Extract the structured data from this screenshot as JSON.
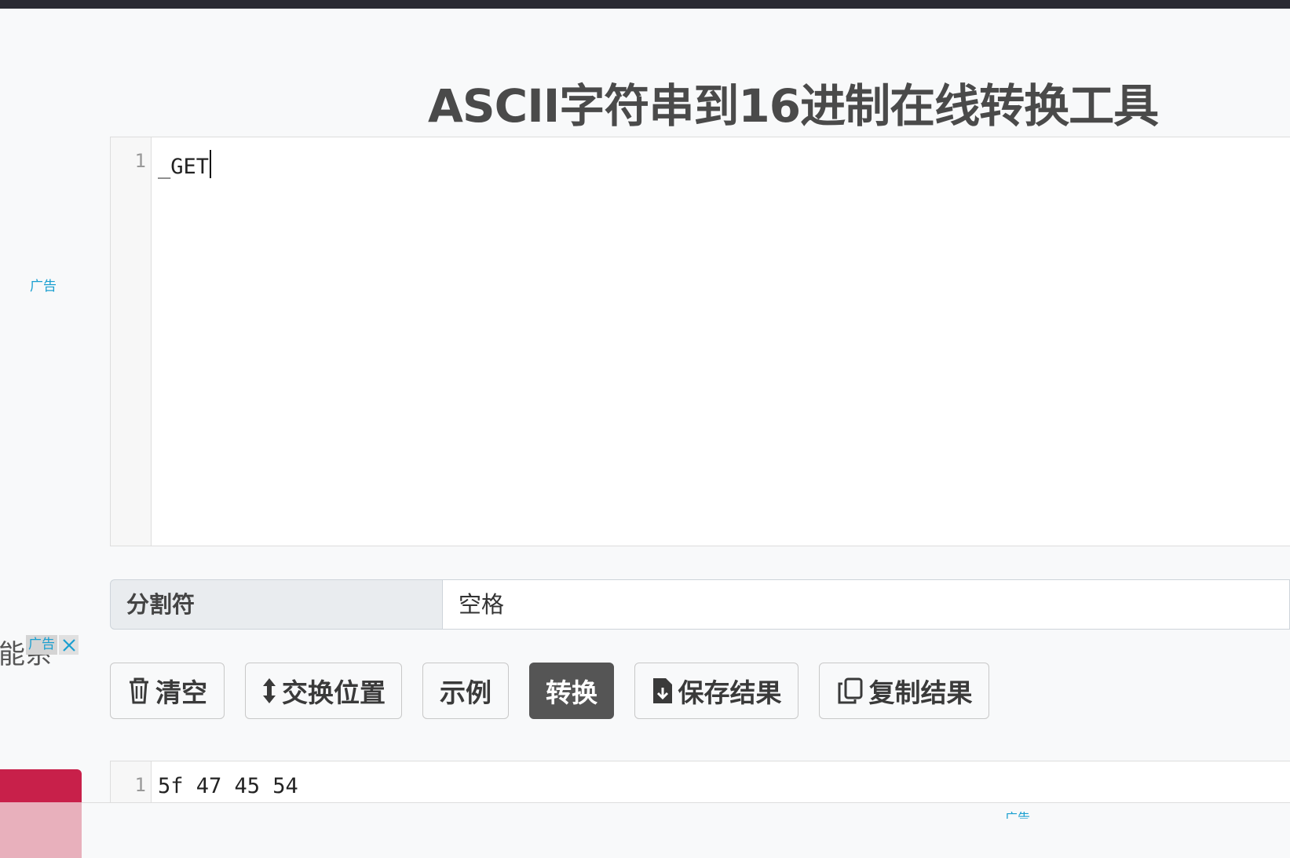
{
  "title": "ASCII字符串到16进制在线转换工具",
  "input_editor": {
    "line_number": "1",
    "text": "_GET"
  },
  "ad_left_label": "广告",
  "separator": {
    "label": "分割符",
    "value": "空格"
  },
  "side_fragment": "能系",
  "ad_badge": {
    "text": "广告",
    "close_icon": "close-icon"
  },
  "buttons": {
    "clear": {
      "label": "清空",
      "icon": "trash-icon"
    },
    "swap": {
      "label": "交换位置",
      "icon": "up-down-arrow-icon"
    },
    "example": {
      "label": "示例"
    },
    "convert": {
      "label": "转换"
    },
    "save": {
      "label": "保存结果",
      "icon": "file-download-icon"
    },
    "copy": {
      "label": "复制结果",
      "icon": "copy-icon"
    }
  },
  "output_editor": {
    "line_number": "1",
    "text": "5f 47 45 54"
  },
  "ad_bottom_label": "广告",
  "colors": {
    "convert_button": "#555555",
    "ad_text": "#1a9fd0",
    "red_block": "#c8204a"
  }
}
